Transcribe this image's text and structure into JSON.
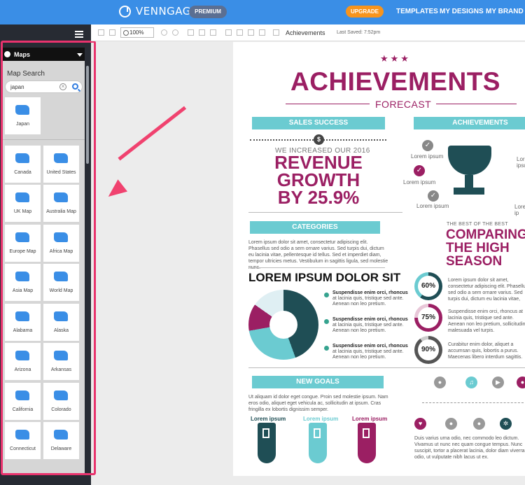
{
  "app": {
    "brand": "VENNGAGE",
    "premium_badge": "PREMIUM",
    "upgrade_label": "UPGRADE",
    "nav": [
      "TEMPLATES",
      "MY DESIGNS",
      "MY BRAND"
    ]
  },
  "toolbar": {
    "zoom": "100%",
    "document_title": "Achievements",
    "last_saved": "Last Saved: 7:52pm"
  },
  "panel": {
    "title": "Maps",
    "search_label": "Map Search",
    "search_value": "japan",
    "search_result": "Japan",
    "maps": [
      "Canada",
      "United States",
      "UK Map",
      "Australia Map",
      "Europe Map",
      "Africa Map",
      "Asia Map",
      "World Map",
      "Alabama",
      "Alaska",
      "Arizona",
      "Arkansas",
      "California",
      "Colorado",
      "Connecticut",
      "Delaware"
    ]
  },
  "infographic": {
    "title": "ACHIEVEMENTS",
    "subtitle": "FORECAST",
    "sales_ribbon": "SALES SUCCESS",
    "achieve_ribbon": "ACHIEVEMENTS",
    "increase_text": "WE INCREASED OUR 2016",
    "revenue_lines": [
      "REVENUE",
      "GROWTH",
      "BY 25.9%"
    ],
    "check_labels": [
      "Lorem ipsum",
      "Lorem ipsum",
      "Lorem ipsum"
    ],
    "trophy_side_label": "Lorem ipsum",
    "trophy_side_label_2": "Lorem ip",
    "categories_ribbon": "CATEGORIES",
    "categories_text": "Lorem ipsum dolor sit amet, consectetur adipiscing elit. Phasellus sed odio a sem ornare varius. Sed turpis dui, dictum eu lacinia vitae, pellentesque id tellus. Sed et imperdiet diam, tempor ultricies metus. Vestibulum in sagittis ligula, sed molestie nunc.",
    "lorem_heading": "LOREM IPSUM DOLOR SIT",
    "bullets": [
      {
        "bold": "Suspendisse enim orci, rhoncus",
        "rest": "at lacinia quis, tristique sed ante. Aenean non leo pretium."
      },
      {
        "bold": "Suspendisse enim orci, rhoncus",
        "rest": "at lacinia quis, tristique sed ante. Aenean non leo pretium."
      },
      {
        "bold": "Suspendisse enim orci, rhoncus",
        "rest": "at lacinia quis, tristique sed ante. Aenean non leo pretium."
      }
    ],
    "best_label": "THE BEST OF THE BEST",
    "compare_lines": [
      "COMPARING",
      "THE HIGH",
      "SEASON"
    ],
    "rings": [
      {
        "value": "60%",
        "text": "Lorem ipsum dolor sit amet, consectetur adipiscing elit. Phasellus sed odio a sem ornare varius. Sed turpis dui, dictum eu lacinia vitae,"
      },
      {
        "value": "75%",
        "text": "Suspendisse enim orci, rhoncus at lacinia quis, tristique sed ante. Aenean non leo pretium, sollicitudin malesuada vel turpis."
      },
      {
        "value": "90%",
        "text": "Curabitur enim dolor, aliquet a accumsan quis, lobortis a purus. Maecenas libero interdum sagittis."
      }
    ],
    "goals_ribbon": "NEW GOALS",
    "goals_text": "Ut aliquam id dolor eget congue. Proin sed molestie ipsum. Nam eros odio, aliquet eget vehicula ac, sollicitudin at ipsum. Cras fringilla ex lobortis dignissim semper.",
    "goal_columns": [
      "Lorem ipsum",
      "Lorem ipsum",
      "Lorem ipsum"
    ],
    "footer_text": "Duis varius urna odio, nec commodo leo dictum. Vivamus ut nunc nec quam congue tempus. Nunc suscipit, tortor a placerat lacinia, dolor diam viverra odio, ut vulputate nibh lacus ut ex."
  },
  "colors": {
    "topbar": "#3a8ee6",
    "accent_pink": "#9b1f63",
    "teal": "#6bcbd1",
    "dark_teal": "#1f4e55",
    "highlight": "#e8336d"
  }
}
